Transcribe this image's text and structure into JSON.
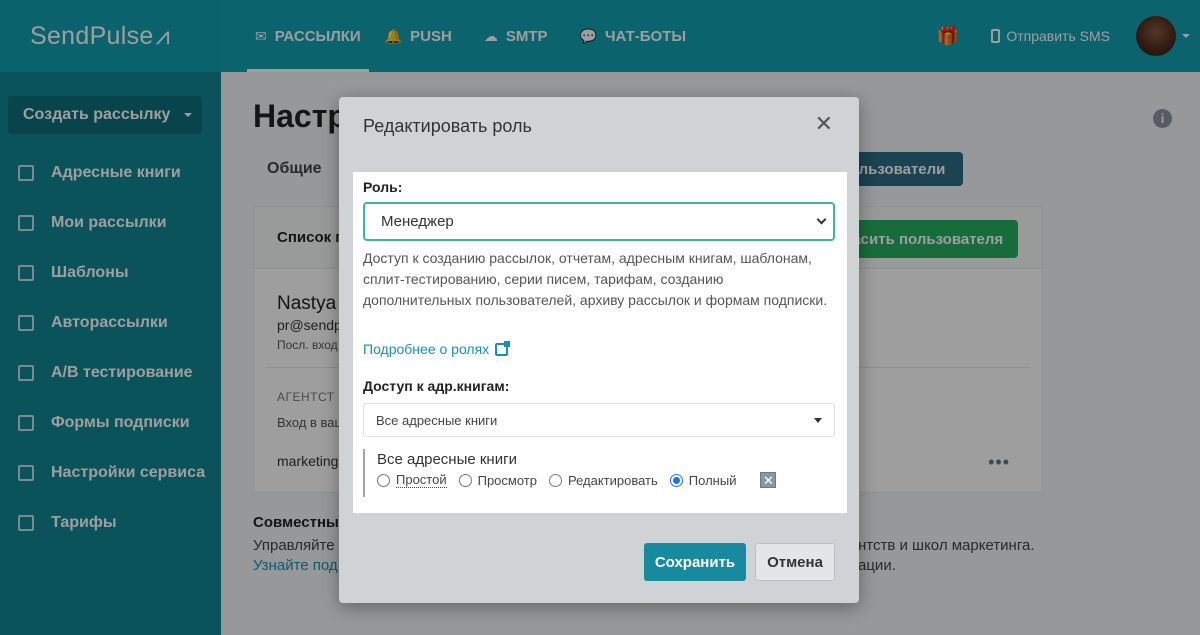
{
  "logo": {
    "text": "SendPulse",
    "pulse": "⩘"
  },
  "sidebar": {
    "create_label": "Создать рассылку",
    "items": [
      {
        "label": "Адресные книги",
        "icon": "address-book-icon"
      },
      {
        "label": "Мои рассылки",
        "icon": "mail-tray-icon"
      },
      {
        "label": "Шаблоны",
        "icon": "template-icon"
      },
      {
        "label": "Авторассылки",
        "icon": "automation-icon"
      },
      {
        "label": "A/B тестирование",
        "icon": "ab-test-icon"
      },
      {
        "label": "Формы подписки",
        "icon": "form-icon"
      },
      {
        "label": "Настройки сервиса",
        "icon": "settings-icon"
      },
      {
        "label": "Тарифы",
        "icon": "pricing-icon"
      }
    ]
  },
  "topnav": {
    "tabs": [
      {
        "label": "РАССЫЛКИ",
        "icon": "✉"
      },
      {
        "label": "PUSH",
        "icon": "🔔"
      },
      {
        "label": "SMTP",
        "icon": "☁"
      },
      {
        "label": "ЧАТ-БОТЫ",
        "icon": "💬"
      }
    ],
    "gift_icon": "🎁",
    "sms_label": "Отправить SMS"
  },
  "main": {
    "title": "Настр",
    "info": "i",
    "tab_general": "Общие",
    "tab_users": "льзователи",
    "list_title": "Список п",
    "invite_label": "ласить пользователя",
    "user_name": "Nastya",
    "user_email": "pr@sendp",
    "user_last": "Посл. вход",
    "agency_title": "АГЕНТСТ",
    "agency_sub": "Вход в ваш",
    "marketing": "marketing",
    "dots": "•••",
    "joint_title": "Совместный",
    "joint_text": "Управляйте",
    "joint_link": "Узнайте под",
    "joint_right1": "нтств и школ маркетинга.",
    "joint_right2": "ации."
  },
  "modal": {
    "title": "Редактировать роль",
    "close": "✕",
    "role_label": "Роль:",
    "role_value": "Менеджер",
    "role_description": "Доступ к созданию рассылок, отчетам, адресным книгам, шаблонам, сплит-тестированию, серии писем, тарифам, созданию дополнительных пользователей, архиву рассылок и формам подписки.",
    "more_link": "Подробнее о ролях",
    "access_label": "Доступ к адр.книгам:",
    "book_value": "Все адресные книги",
    "perm_title": "Все адресные книги",
    "perms": [
      "Простой",
      "Просмотр",
      "Редактировать",
      "Полный"
    ],
    "perm_selected": "Полный",
    "remove": "✕",
    "save": "Сохранить",
    "cancel": "Отмена"
  }
}
